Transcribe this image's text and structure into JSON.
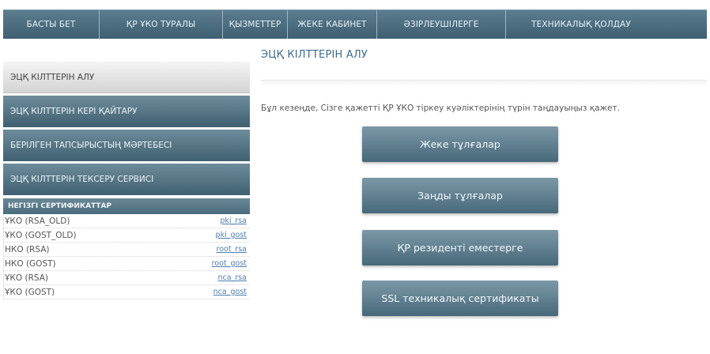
{
  "nav": {
    "items": [
      {
        "label": "Басты бет",
        "width": 122
      },
      {
        "label": "ҚР ҰКО туралы",
        "width": 156
      },
      {
        "label": "Қызметтер",
        "width": 82
      },
      {
        "label": "Жеке кабинет",
        "width": 113
      },
      {
        "label": "Әзірлеушілерге",
        "width": 163
      },
      {
        "label": "Техникалық қолдау",
        "width": 190
      }
    ]
  },
  "sidebar": {
    "items": [
      {
        "label": "ЭЦҚ кілттерін алу",
        "state": "active"
      },
      {
        "label": "ЭЦҚ кілттерін кері қайтару",
        "state": "dark"
      },
      {
        "label": "Берілген тапсырыстың мәртебесі",
        "state": "dark"
      },
      {
        "label": "ЭЦҚ кілттерін тексеру сервисі",
        "state": "dark"
      }
    ],
    "certificates": {
      "header": "Негізгі сертификаттар",
      "rows": [
        {
          "name": "ҰКО (RSA_OLD)",
          "link": "pki_rsa"
        },
        {
          "name": "ҰКО (GOST_OLD)",
          "link": "pki_gost"
        },
        {
          "name": "НКО (RSA)",
          "link": "root_rsa"
        },
        {
          "name": "НКО (GOST)",
          "link": "root_gost"
        },
        {
          "name": "ҰКО (RSA)",
          "link": "nca_rsa"
        },
        {
          "name": "ҰКО (GOST)",
          "link": "nca_gost"
        }
      ]
    }
  },
  "main": {
    "title": "ЭЦҚ кілттерін алу",
    "instruction": "Бұл кезеңде, Сізге қажетті ҚР ҰКО тіркеу куәліктерінің түрін таңдауыңыз қажет.",
    "buttons": [
      {
        "label": "Жеке тұлғалар"
      },
      {
        "label": "Заңды тұлғалар"
      },
      {
        "label": "ҚР резиденті еместерге"
      },
      {
        "label": "SSL техникалық сертификаты"
      }
    ]
  },
  "colors": {
    "nav_bg": "#4a6b7d",
    "button_bg": "#5b7e90",
    "title": "#3d6b8a",
    "link": "#4f7fb3"
  }
}
